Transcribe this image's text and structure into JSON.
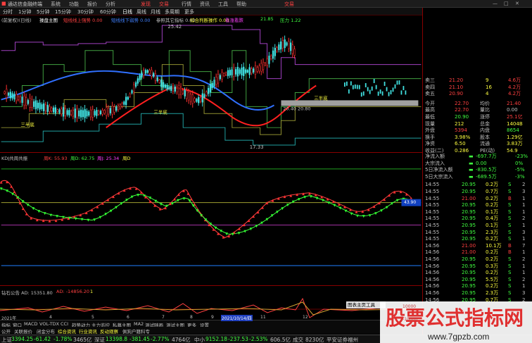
{
  "window": {
    "title": "通达信金融终端",
    "menus": [
      "系统",
      "功能",
      "报价",
      "分析",
      "行情",
      "资讯",
      "工具",
      "帮助"
    ],
    "right_menus": [
      "发现",
      "交易"
    ],
    "right_label": "交易"
  },
  "toolbar": {
    "items": [
      "分时",
      "1分钟",
      "5分钟",
      "15分钟",
      "30分钟",
      "60分钟",
      "日线",
      "周线",
      "月线",
      "多周期",
      "更多"
    ]
  },
  "indicator_bar": {
    "items": [
      {
        "text": "(前复权)(日线)",
        "color": "#c0c0c0"
      },
      {
        "text": "操盘主图",
        "color": "#ffffff"
      },
      {
        "text": "短线线上强势 0.00",
        "color": "#ff4040"
      },
      {
        "text": "短线线下弱势 0.00",
        "color": "#4080ff"
      },
      {
        "text": "参照其它指标 0.00",
        "color": "#c0c0c0"
      },
      {
        "text": "综合判断操作 0.00",
        "color": "#ffff40"
      },
      {
        "text": "看涨看跌",
        "color": "#ff40ff"
      },
      {
        "text": "21.85",
        "color": "#40ff40"
      },
      {
        "text": "压力 1.22",
        "color": "#40ff40"
      }
    ]
  },
  "main_chart": {
    "price_high_label": "25.42",
    "price_low_label": "17.33",
    "mid_label": "20.40 20.80",
    "annotation1": "三半底",
    "annotation2": "三半底",
    "annotation3": "三半底"
  },
  "kdj_bar": {
    "items": [
      {
        "text": "KDJ共周共振",
        "color": "#c0c0c0"
      },
      {
        "text": "周K: 55.93",
        "color": "#ff4040"
      },
      {
        "text": "周D: 62.75",
        "color": "#40ff40"
      },
      {
        "text": "周J: 25.34",
        "color": "#ff40ff"
      },
      {
        "text": "周D",
        "color": "#ffff40"
      }
    ],
    "y_labels": [
      "90.00",
      "80.00",
      "70.00",
      "60.00",
      "50.00",
      "40.00",
      "30.00",
      "20.00",
      "10.00"
    ],
    "highlight_label": "43.90"
  },
  "ad_bar": {
    "items": [
      {
        "text": "钻石公告 AD: 15351.80",
        "color": "#c0c0c0"
      },
      {
        "text": "AD: -14856.20",
        "color": "#ff4040"
      },
      {
        "text": "1",
        "color": "#ffff40"
      }
    ],
    "y_labels": [
      "10000",
      "-10000"
    ],
    "popup": "图表主页工具"
  },
  "date_bar": {
    "labels": [
      "2021年",
      "4",
      "5",
      "6",
      "7",
      "8",
      "9",
      "2021/10/14/四",
      "11",
      "12"
    ]
  },
  "taskbar1": {
    "items": [
      "指标",
      "窗口",
      "MACD",
      "VOL-TDX",
      "CCI",
      "趋势动力",
      "主力监控",
      "私募主图",
      "MA2",
      "测试随画",
      "测试主图",
      "更多",
      "设置"
    ]
  },
  "taskbar2": {
    "items": [
      "公开",
      "关联报价",
      "闭金分布",
      "综合资讯",
      "行业资讯",
      "反动观察",
      "佩狗户籍科专"
    ]
  },
  "quote_panel": {
    "order_book": [
      {
        "label": "卖三",
        "price": "21.20",
        "vol": "9",
        "vol_color": "#ffff40",
        "chg": "4.6万",
        "chg_color": "#ff4040"
      },
      {
        "label": "卖四",
        "price": "21.10",
        "vol": "16",
        "vol_color": "#ffff40",
        "chg": "4.2万",
        "chg_color": "#ff4040"
      },
      {
        "label": "卖五",
        "price": "20.90",
        "vol": "4",
        "vol_color": "#ffff40",
        "chg": "4.2万",
        "chg_color": "#ff4040"
      }
    ],
    "stats": [
      {
        "l1": "今开",
        "v1": "22.70",
        "c1": "#ff4040",
        "l2": "均价",
        "v2": "21.40",
        "c2": "#ff4040"
      },
      {
        "l1": "最高",
        "v1": "22.70",
        "c1": "#ff4040",
        "l2": "量比",
        "v2": "0.00",
        "c2": "#c0c0c0"
      },
      {
        "l1": "最低",
        "v1": "20.90",
        "c1": "#40ff40",
        "l2": "涨停",
        "v2": "25.1亿",
        "c2": "#ff4040"
      },
      {
        "l1": "现量",
        "v1": "212",
        "c1": "#ffff40",
        "l2": "总金",
        "v2": "1404B",
        "c2": "#ffff40"
      },
      {
        "l1": "外盘",
        "v1": "5394",
        "c1": "#ff4040",
        "l2": "内盘",
        "v2": "8654",
        "c2": "#40ff40"
      },
      {
        "l1": "换手",
        "v1": "3.98%",
        "c1": "#ffff40",
        "l2": "股本",
        "v2": "1.29亿",
        "c2": "#ffff40"
      },
      {
        "l1": "净资",
        "v1": "6.50",
        "c1": "#ffff40",
        "l2": "流通",
        "v2": "3.83万",
        "c2": "#ffff40"
      },
      {
        "l1": "收益(二)",
        "v1": "0.286",
        "c1": "#ffff40",
        "l2": "PE(动)",
        "v2": "54.9",
        "c2": "#ffff40"
      }
    ],
    "flows": [
      {
        "label": "净流入额",
        "val": "-697.7万",
        "pct": "-23%"
      },
      {
        "label": "大宗流入",
        "val": "0.00",
        "pct": "0%"
      },
      {
        "label": "5日净流入额",
        "val": "-830.5万",
        "pct": "-5%"
      },
      {
        "label": "5日大宗流入",
        "val": "-689.5万",
        "pct": "-3%"
      }
    ],
    "ticks": [
      {
        "t": "14:55",
        "p": "20.95",
        "v": "0.2万",
        "f": "S",
        "n": "2"
      },
      {
        "t": "14:55",
        "p": "20.95",
        "v": "0.7万",
        "f": "S",
        "n": "3"
      },
      {
        "t": "14:55",
        "p": "21.00",
        "v": "0.2万",
        "f": "B",
        "n": "1"
      },
      {
        "t": "14:55",
        "p": "20.95",
        "v": "0.2万",
        "f": "S",
        "n": "1"
      },
      {
        "t": "14:55",
        "p": "20.95",
        "v": "0.1万",
        "f": "S",
        "n": "1"
      },
      {
        "t": "14:55",
        "p": "20.95",
        "v": "0.4万",
        "f": "S",
        "n": "2"
      },
      {
        "t": "14:55",
        "p": "20.95",
        "v": "0.1万",
        "f": "S",
        "n": "1"
      },
      {
        "t": "14:55",
        "p": "20.95",
        "v": "2.3万",
        "f": "S",
        "n": "3"
      },
      {
        "t": "14:55",
        "p": "20.95",
        "v": "0.2万",
        "f": "S",
        "n": "1"
      },
      {
        "t": "14:56",
        "p": "21.00",
        "v": "10.1万",
        "f": "B",
        "n": "7"
      },
      {
        "t": "14:56",
        "p": "21.00",
        "v": "0.2万",
        "f": "B",
        "n": "1"
      },
      {
        "t": "14:56",
        "p": "20.95",
        "v": "0.2万",
        "f": "S",
        "n": "2"
      },
      {
        "t": "14:56",
        "p": "20.95",
        "v": "0.3万",
        "f": "S",
        "n": "1"
      },
      {
        "t": "14:56",
        "p": "20.95",
        "v": "0.2万",
        "f": "S",
        "n": "1"
      },
      {
        "t": "14:56",
        "p": "20.95",
        "v": "5.5万",
        "f": "S",
        "n": "2"
      },
      {
        "t": "14:56",
        "p": "20.95",
        "v": "0.2万",
        "f": "S",
        "n": "1"
      },
      {
        "t": "14:56",
        "p": "20.95",
        "v": "2.3万",
        "f": "S",
        "n": "3"
      },
      {
        "t": "14:56",
        "p": "20.95",
        "v": "0.7万",
        "f": "S",
        "n": "2"
      }
    ],
    "right_scale": [
      "22.00",
      "21.00",
      "20.00",
      "19.00"
    ]
  },
  "statusbar": {
    "items": [
      {
        "text": "上证",
        "color": "#c0c0c0"
      },
      {
        "text": "3394.25",
        "color": "#40ff40"
      },
      {
        "text": "-61.42",
        "color": "#40ff40"
      },
      {
        "text": "-1.78%",
        "color": "#40ff40"
      },
      {
        "text": "3465亿",
        "color": "#c0c0c0"
      },
      {
        "text": "深证",
        "color": "#c0c0c0"
      },
      {
        "text": "13398.8",
        "color": "#40ff40"
      },
      {
        "text": "-381.45",
        "color": "#40ff40"
      },
      {
        "text": "-2.77%",
        "color": "#40ff40"
      },
      {
        "text": "4764亿",
        "color": "#c0c0c0"
      },
      {
        "text": "中小",
        "color": "#c0c0c0"
      },
      {
        "text": "9152.18",
        "color": "#40ff40"
      },
      {
        "text": "-237.53",
        "color": "#40ff40"
      },
      {
        "text": "-2.53%",
        "color": "#40ff40"
      },
      {
        "text": "606.5亿",
        "color": "#c0c0c0"
      },
      {
        "text": "成交",
        "color": "#c0c0c0"
      },
      {
        "text": "8230亿",
        "color": "#c0c0c0"
      },
      {
        "text": "平安证券福州",
        "color": "#c0c0c0"
      }
    ]
  },
  "watermark": {
    "title": "股票公式指标网",
    "url": "www.7gpzb.com"
  }
}
